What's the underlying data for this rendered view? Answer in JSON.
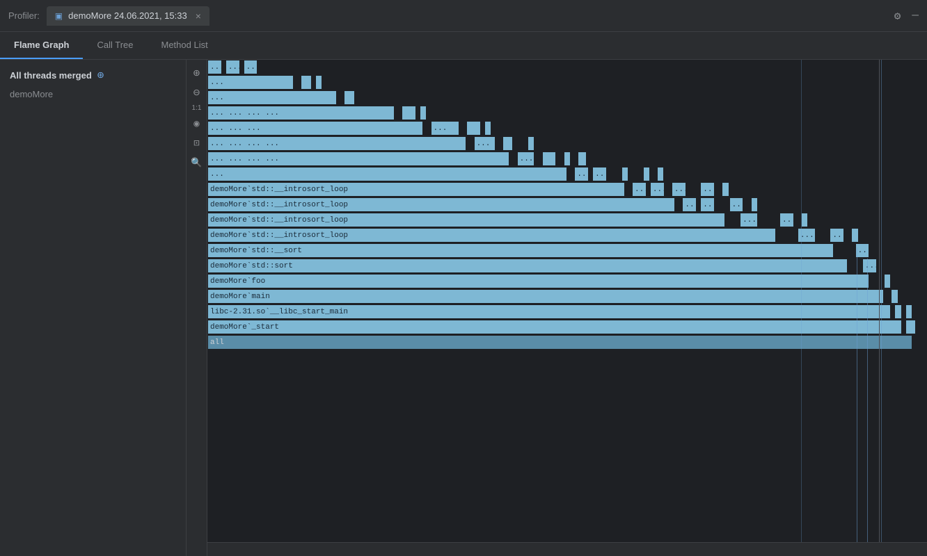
{
  "titleBar": {
    "appLabel": "Profiler:",
    "tabIcon": "▣",
    "tabTitle": "demoMore 24.06.2021, 15:33",
    "closeBtn": "×",
    "gearIcon": "⚙",
    "minimizeIcon": "—"
  },
  "tabs": [
    {
      "id": "flame-graph",
      "label": "Flame Graph",
      "active": true
    },
    {
      "id": "call-tree",
      "label": "Call Tree",
      "active": false
    },
    {
      "id": "method-list",
      "label": "Method List",
      "active": false
    }
  ],
  "sidebar": {
    "title": "All threads merged",
    "addIcon": "⊕",
    "minusIcon": "⊖",
    "items": [
      {
        "label": "demoMore"
      }
    ]
  },
  "toolbar": {
    "zoomIn": "⊕",
    "zoomOut": "⊖",
    "ratio": "1:1",
    "eye": "◉",
    "camera": "⌖",
    "search": "🔍"
  },
  "flameRows": [
    {
      "blocks": [
        {
          "label": "...",
          "w": 3
        },
        {
          "label": "...",
          "w": 3
        },
        {
          "label": "...",
          "w": 3
        }
      ],
      "topOffset": 0,
      "leftPct": 1
    },
    {
      "label": "..."
    },
    {
      "label": "..."
    },
    {
      "label": "... ... ... ..."
    },
    {
      "label": "... ... ... ..."
    },
    {
      "label": "... ... ... ..."
    },
    {
      "label": "... ... ... ..."
    },
    {
      "label": "..."
    },
    {
      "label": "demoMore`std::__introsort_loop  ...  ...  ...  ..."
    },
    {
      "label": "demoMore`std::__introsort_loop  ...  ...  ..."
    },
    {
      "label": "demoMore`std::__introsort_loop  ...  ..."
    },
    {
      "label": "demoMore`std::__introsort_loop  ...  ..."
    },
    {
      "label": "demoMore`std::__sort  ..."
    },
    {
      "label": "demoMore`std::sort  ..."
    },
    {
      "label": "demoMore`foo"
    },
    {
      "label": "demoMore`main"
    },
    {
      "label": "libc-2.31.so`__libc_start_main"
    },
    {
      "label": "demoMore`_start"
    },
    {
      "label": "all"
    }
  ],
  "accent": "#7eb8d4",
  "colors": {
    "bg": "#1e2024",
    "sidebar": "#2b2d30",
    "border": "#3d3f43",
    "flameBlock": "#7eb8d4",
    "flameText": "#1a2a38"
  }
}
